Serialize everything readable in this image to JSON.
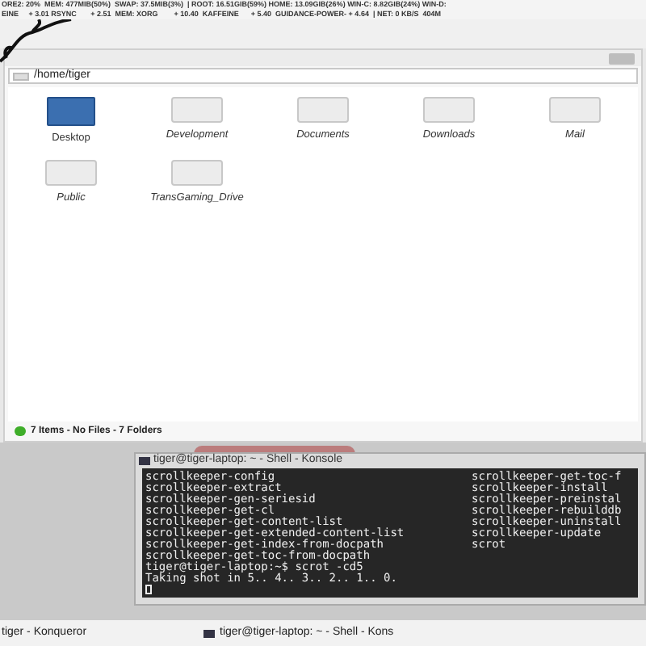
{
  "system_monitor": {
    "lines": [
      "ORE2: 20%  MEM: 477MIB(50%)  SWAP: 37.5MIB(3%)  | ROOT: 16.51GIB(59%) HOME: 13.09GIB(26%) WIN-C: 8.82GIB(24%) WIN-D:",
      "EINE     + 3.01 RSYNC       + 2.51  MEM: XORG        + 10.40  KAFFEINE      + 5.40  GUIDANCE-POWER- + 4.64  | NET: 0 KB/S  404M"
    ]
  },
  "file_manager": {
    "location": "/home/tiger",
    "items": [
      {
        "name": "Desktop",
        "kind": "desktop"
      },
      {
        "name": "Development",
        "kind": "folder"
      },
      {
        "name": "Documents",
        "kind": "folder"
      },
      {
        "name": "Downloads",
        "kind": "folder"
      },
      {
        "name": "Mail",
        "kind": "folder"
      },
      {
        "name": "Public",
        "kind": "folder"
      },
      {
        "name": "TransGaming_Drive",
        "kind": "folder"
      }
    ],
    "status": "7 Items - No Files - 7 Folders"
  },
  "terminal": {
    "title": "tiger@tiger-laptop: ~ - Shell - Konsole",
    "rows": [
      {
        "left": "scrollkeeper-config",
        "right": "scrollkeeper-get-toc-f"
      },
      {
        "left": "scrollkeeper-extract",
        "right": "scrollkeeper-install"
      },
      {
        "left": "scrollkeeper-gen-seriesid",
        "right": "scrollkeeper-preinstal"
      },
      {
        "left": "scrollkeeper-get-cl",
        "right": "scrollkeeper-rebuilddb"
      },
      {
        "left": "scrollkeeper-get-content-list",
        "right": "scrollkeeper-uninstall"
      },
      {
        "left": "scrollkeeper-get-extended-content-list",
        "right": "scrollkeeper-update"
      },
      {
        "left": "scrollkeeper-get-index-from-docpath",
        "right": "scrot"
      },
      {
        "left": "scrollkeeper-get-toc-from-docpath"
      },
      {
        "left": "tiger@tiger-laptop:~$ scrot -cd5"
      },
      {
        "left": "Taking shot in 5.. 4.. 3.. 2.. 1.. 0."
      }
    ]
  },
  "taskbar": [
    {
      "label": "tiger - Konqueror",
      "kind": "browser"
    },
    {
      "label": "tiger@tiger-laptop: ~ - Shell - Kons",
      "kind": "terminal"
    }
  ]
}
